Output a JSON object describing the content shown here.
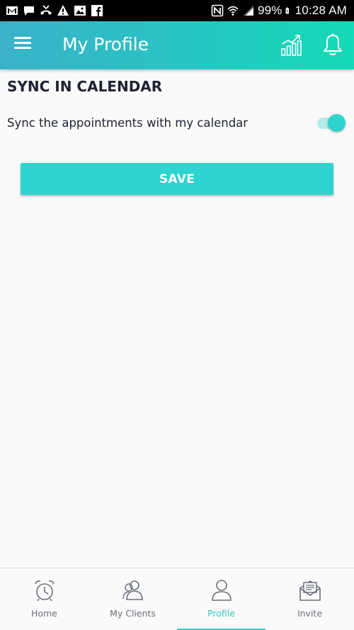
{
  "status_bar": {
    "battery": "99%",
    "time": "10:28 AM",
    "left_icons": [
      "gmail-icon",
      "message-icon",
      "missed-call-icon",
      "warning-icon",
      "image-icon",
      "facebook-icon"
    ],
    "right_icons": [
      "nfc-icon",
      "wifi-icon",
      "signal-icon",
      "battery-icon"
    ]
  },
  "app_bar": {
    "title": "My Profile",
    "accent_gradient": [
      "#3bb1c9",
      "#14dab5"
    ]
  },
  "section": {
    "title": "SYNC IN CALENDAR",
    "sync_label": "Sync the appointments with my calendar",
    "sync_enabled": true
  },
  "save_label": "SAVE",
  "bottom_nav": {
    "items": [
      {
        "label": "Home",
        "icon": "alarm-clock-icon",
        "active": false
      },
      {
        "label": "My Clients",
        "icon": "clients-icon",
        "active": false
      },
      {
        "label": "Profile",
        "icon": "profile-icon",
        "active": true
      },
      {
        "label": "Invite",
        "icon": "envelope-icon",
        "active": false
      }
    ]
  },
  "colors": {
    "accent": "#2fd3cf",
    "text_dark": "#1e2233",
    "nav_inactive": "#6b6f7c"
  }
}
